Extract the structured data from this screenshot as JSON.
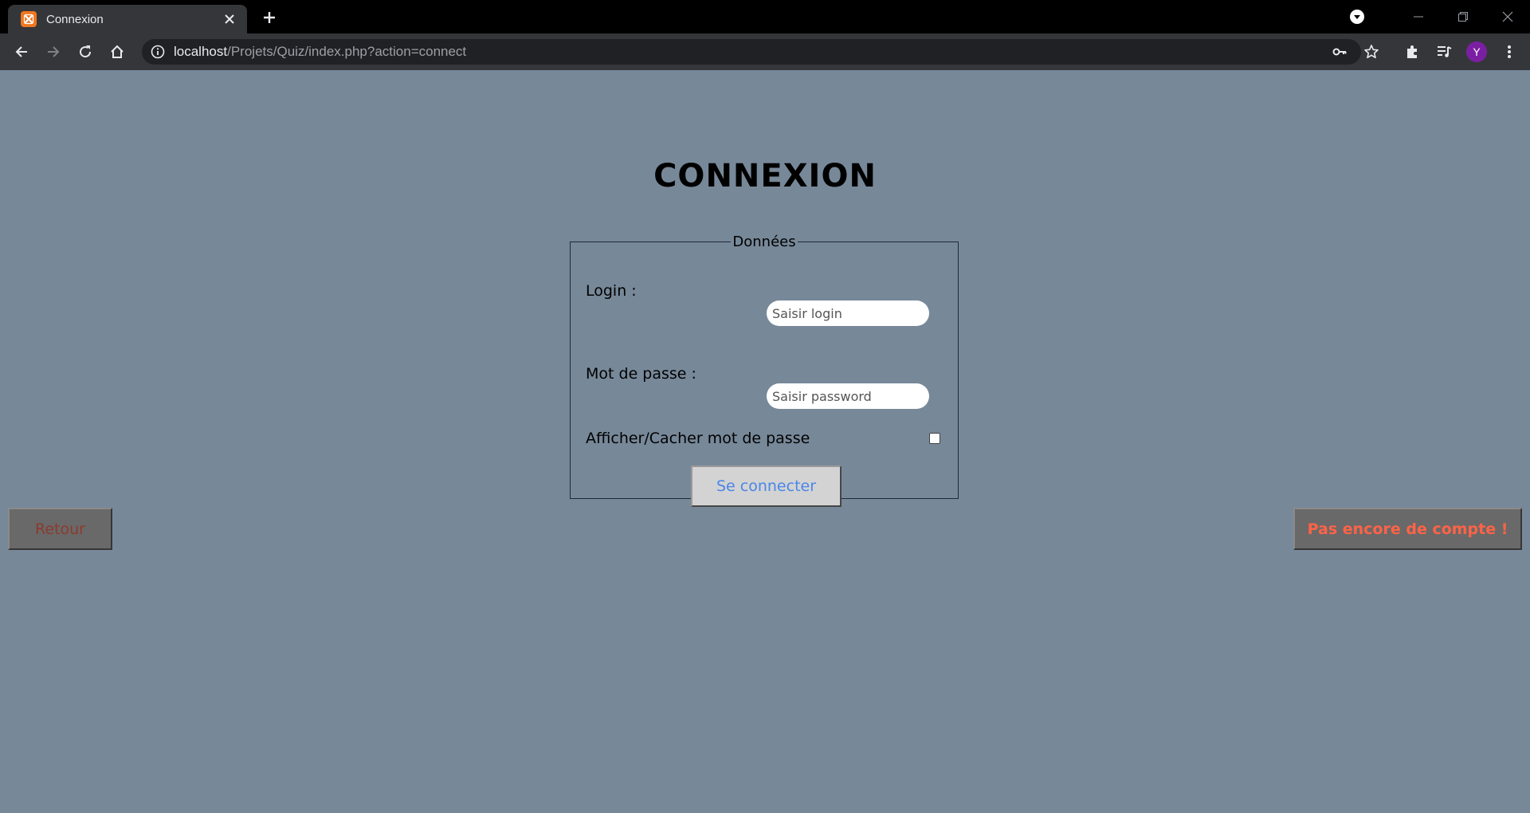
{
  "browser": {
    "tab": {
      "title": "Connexion",
      "favicon": "xampp-icon"
    },
    "url": {
      "host": "localhost",
      "path": "/Projets/Quiz/index.php?action=connect"
    },
    "profile_initial": "Y",
    "profile_color": "#7b1fa2"
  },
  "page": {
    "title": "CONNEXION",
    "background": "#778899",
    "form": {
      "legend": "Données",
      "login_label": "Login :",
      "login_placeholder": "Saisir login",
      "login_value": "",
      "password_label": "Mot de passe :",
      "password_placeholder": "Saisir password",
      "password_value": "",
      "toggle_label": "Afficher/Cacher mot de passe",
      "toggle_checked": false,
      "submit_label": "Se connecter"
    },
    "back_button": "Retour",
    "signup_button": "Pas encore de compte !"
  }
}
